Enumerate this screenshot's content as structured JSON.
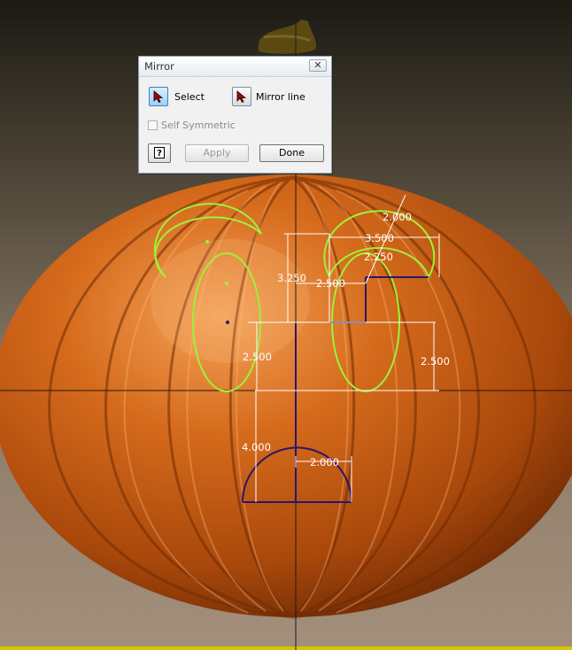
{
  "colors": {
    "sketch_curve": "#9cf23a",
    "constrained_geometry": "#2a1470",
    "dimension_text": "#ffffff",
    "pumpkin_base": "#c25c10",
    "background": "#8a7a69"
  },
  "sketch": {
    "dimensions": {
      "d1": "2.000",
      "d2": "3.500",
      "d3": "2.250",
      "d4": "3.250",
      "d5": "2.500",
      "d6": "2.500",
      "d7": "2.500",
      "d8": "4.000",
      "d9": "2.000"
    }
  },
  "mirror_dialog": {
    "title": "Mirror",
    "close_glyph": "✕",
    "select_label": "Select",
    "mirror_line_label": "Mirror line",
    "self_symmetric_label": "Self Symmetric",
    "self_symmetric_checked": false,
    "help_glyph": "?",
    "apply_label": "Apply",
    "done_label": "Done"
  }
}
